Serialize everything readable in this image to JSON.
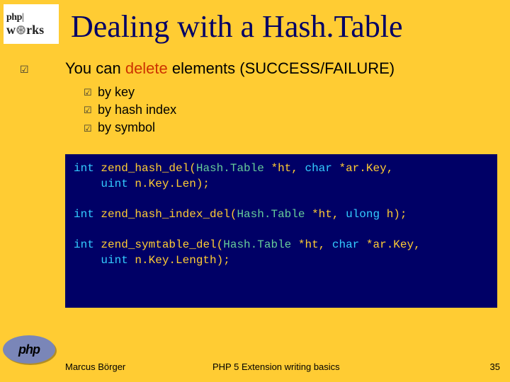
{
  "logo": {
    "line1_a": "php",
    "line1_b": "|",
    "line2_a": "w",
    "line2_gear": "⊛",
    "line2_b": "rks"
  },
  "title": "Dealing with a Hash.Table",
  "main": {
    "bullet": "☑",
    "text_pre": "You can ",
    "text_del": "delete",
    "text_post": " elements (SUCCESS/FAILURE)"
  },
  "sub": [
    {
      "bullet": "☑",
      "text": "by key"
    },
    {
      "bullet": "☑",
      "text": "by hash index"
    },
    {
      "bullet": "☑",
      "text": "by symbol"
    }
  ],
  "code": {
    "l1a": "int",
    "l1b": " zend_hash_del(",
    "l1c": "Hash.Table",
    "l1d": " *ht, ",
    "l1e": "char",
    "l1f": " *ar.Key,",
    "l2a": "uint",
    "l2b": " n.Key.Len);",
    "l3a": "int",
    "l3b": " zend_hash_index_del(",
    "l3c": "Hash.Table",
    "l3d": " *ht, ",
    "l3e": "ulong",
    "l3f": " h);",
    "l4a": "int",
    "l4b": " zend_symtable_del(",
    "l4c": "Hash.Table",
    "l4d": " *ht, ",
    "l4e": "char",
    "l4f": " *ar.Key,",
    "l5a": "uint",
    "l5b": " n.Key.Length);"
  },
  "php_logo": "php",
  "footer": {
    "author": "Marcus Börger",
    "title": "PHP 5 Extension writing basics",
    "page": "35"
  }
}
